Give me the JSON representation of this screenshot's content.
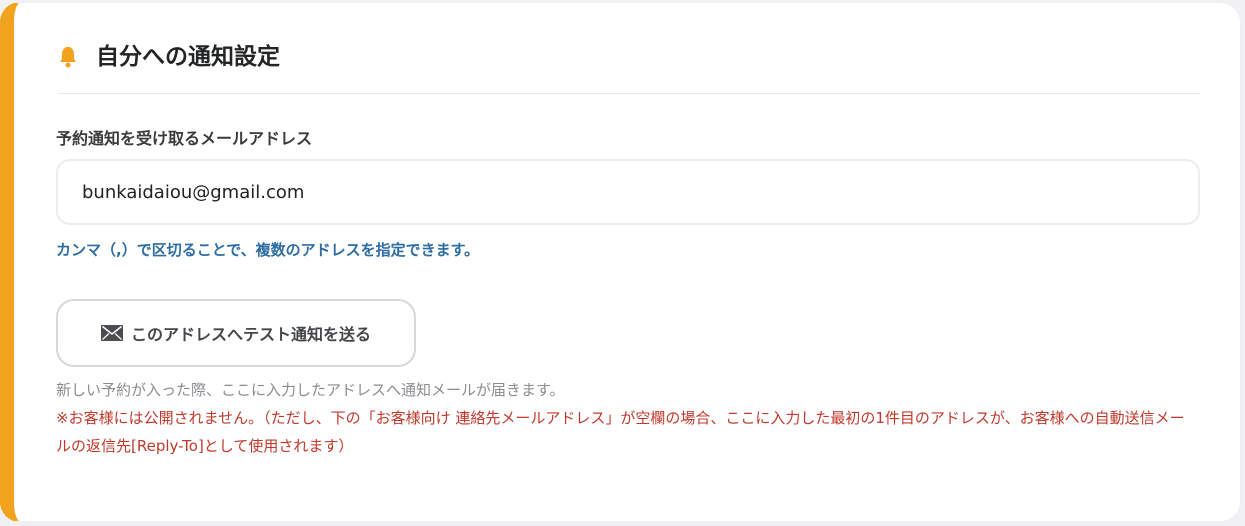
{
  "section": {
    "title": "自分への通知設定",
    "icon": "bell-icon",
    "accent_color": "#f2a21c"
  },
  "email_field": {
    "label": "予約通知を受け取るメールアドレス",
    "value": "bunkaidaiou@gmail.com",
    "hint": "カンマ（,）で区切ることで、複数のアドレスを指定できます。"
  },
  "test_button": {
    "icon": "mail-icon",
    "label": "このアドレスへテスト通知を送る"
  },
  "notes": {
    "info": "新しい予約が入った際、ここに入力したアドレスへ通知メールが届きます。",
    "warning": "※お客様には公開されません。（ただし、下の「お客様向け 連絡先メールアドレス」が空欄の場合、ここに入力した最初の1件目のアドレスが、お客様への自動送信メールの返信先[Reply-To]として使用されます）"
  }
}
